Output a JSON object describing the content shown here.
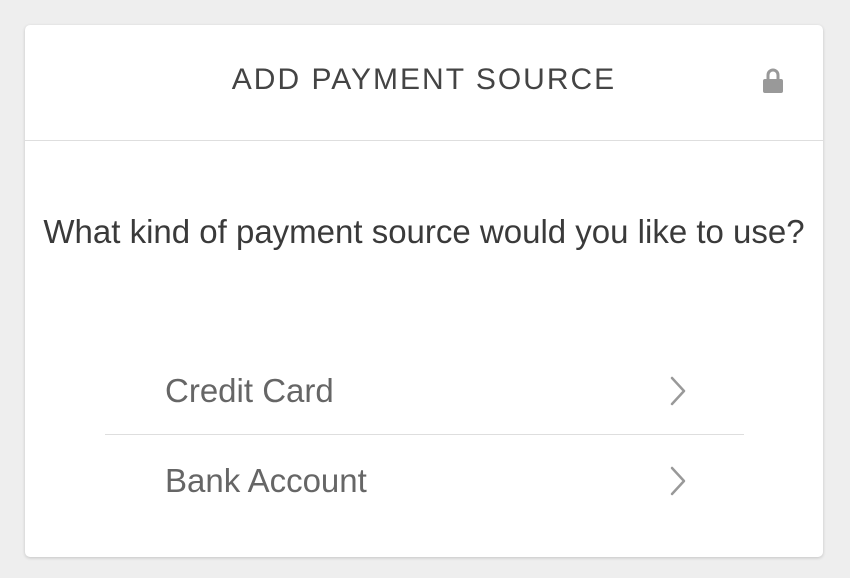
{
  "modal": {
    "title": "ADD PAYMENT SOURCE",
    "lock_icon": "lock-icon",
    "question": "What kind of payment source would you like to use?",
    "options": [
      {
        "label": "Credit Card",
        "icon": "chevron-right-icon"
      },
      {
        "label": "Bank Account",
        "icon": "chevron-right-icon"
      }
    ]
  },
  "colors": {
    "background": "#eeeeee",
    "card": "#ffffff",
    "title_text": "#444444",
    "question_text": "#3a3a3a",
    "option_text": "#666666",
    "icon": "#999999",
    "divider": "#dedede"
  }
}
